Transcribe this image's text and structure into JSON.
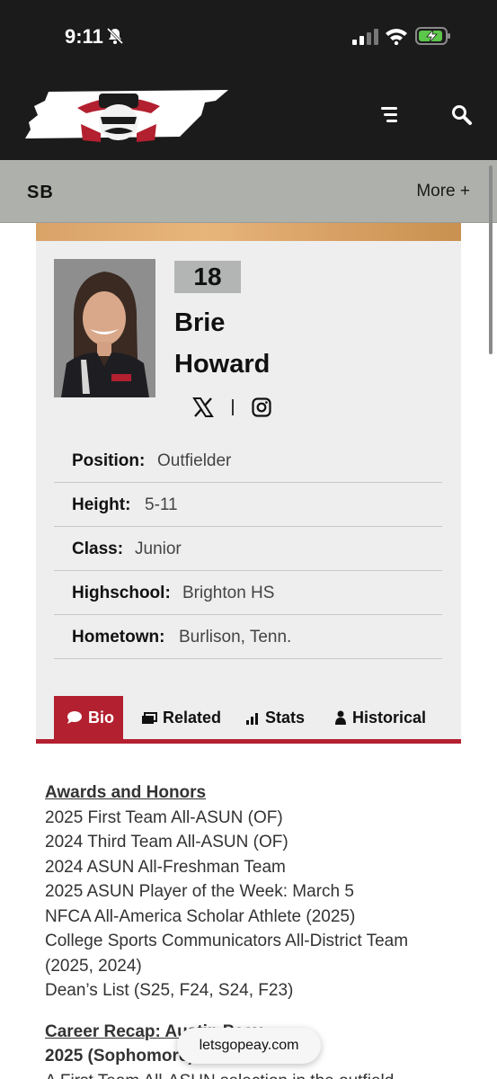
{
  "status_bar": {
    "time": "9:11"
  },
  "header": {
    "menu_icon": "hamburger-icon",
    "search_icon": "search-icon"
  },
  "subnav": {
    "title": "SB",
    "more_label": "More +"
  },
  "player": {
    "number": "18",
    "first_name": "Brie",
    "last_name": "Howard",
    "socials": [
      "x-icon",
      "instagram-icon"
    ]
  },
  "info": [
    {
      "label": "Position:",
      "value": "Outfielder"
    },
    {
      "label": "Height:",
      "value": "5-11"
    },
    {
      "label": "Class:",
      "value": "Junior"
    },
    {
      "label": "Highschool:",
      "value": "Brighton HS"
    },
    {
      "label": "Hometown:",
      "value": "Burlison, Tenn."
    }
  ],
  "tabs": [
    {
      "label": "Bio",
      "icon": "comment-icon",
      "active": true
    },
    {
      "label": "Related",
      "icon": "images-icon",
      "active": false
    },
    {
      "label": "Stats",
      "icon": "bar-chart-icon",
      "active": false
    },
    {
      "label": "Historical",
      "icon": "user-icon",
      "active": false
    }
  ],
  "bio": {
    "awards_heading": "Awards and Honors",
    "awards": [
      "2025 First Team All-ASUN (OF)",
      "2024 Third Team All-ASUN (OF)",
      "2024 ASUN All-Freshman Team",
      "2025 ASUN Player of the Week: March 5",
      "NFCA All-America Scholar Athlete (2025)",
      "College Sports Communicators All-District Team (2025, 2024)",
      "Dean’s List (S25, F24, S24, F23)"
    ],
    "recap_heading": "Career Recap: Austin Peay",
    "recap_year": "2025 (Sophomore)",
    "recap_text": "A First Team All-ASUN selection in the outfield"
  },
  "url_bar": {
    "domain": "letsgopeay.com"
  },
  "colors": {
    "accent": "#b3202f",
    "header_bg": "#1b1b1b",
    "subnav_bg": "#aeb1ab",
    "card_bg": "#eeeeee"
  }
}
